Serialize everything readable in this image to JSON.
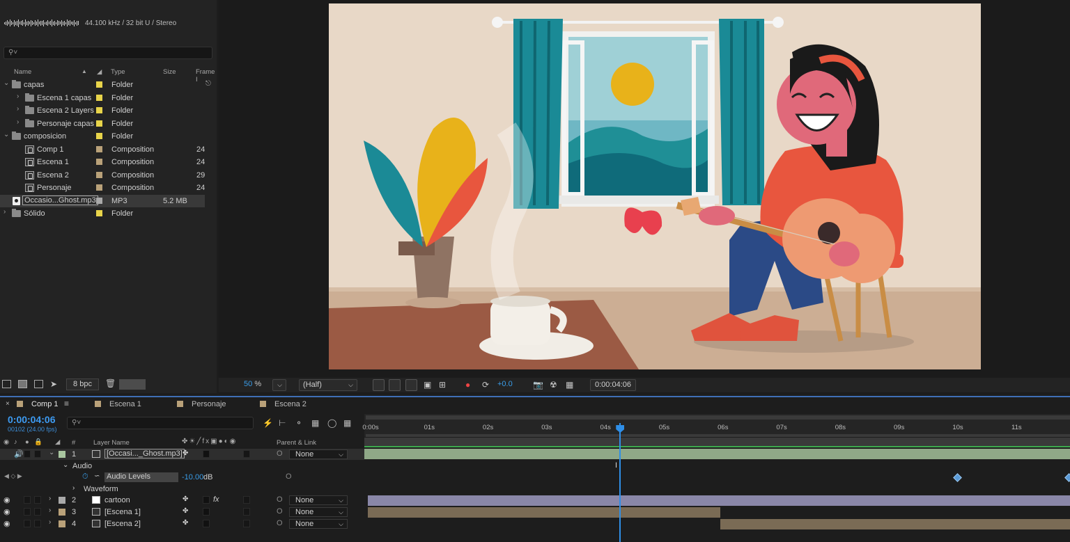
{
  "project": {
    "audio_info": "44.100 kHz / 32 bit U / Stereo",
    "columns": {
      "name": "Name",
      "type": "Type",
      "size": "Size",
      "frame": "Frame I"
    },
    "items": [
      {
        "name": "capas",
        "type": "Folder",
        "size": "",
        "frame": "",
        "label": "#e8d44a",
        "kind": "folder",
        "indent": 0,
        "open": true
      },
      {
        "name": "Escena 1 capas",
        "type": "Folder",
        "size": "",
        "frame": "",
        "label": "#e8d44a",
        "kind": "folder",
        "indent": 1,
        "open": false
      },
      {
        "name": "Escena 2 Layers",
        "type": "Folder",
        "size": "",
        "frame": "",
        "label": "#e8d44a",
        "kind": "folder",
        "indent": 1,
        "open": false
      },
      {
        "name": "Personaje capas",
        "type": "Folder",
        "size": "",
        "frame": "",
        "label": "#e8d44a",
        "kind": "folder",
        "indent": 1,
        "open": false
      },
      {
        "name": "composicion",
        "type": "Folder",
        "size": "",
        "frame": "",
        "label": "#e8d44a",
        "kind": "folder",
        "indent": 0,
        "open": true
      },
      {
        "name": "Comp 1",
        "type": "Composition",
        "size": "",
        "frame": "24",
        "label": "#b9a179",
        "kind": "comp",
        "indent": 1
      },
      {
        "name": "Escena 1",
        "type": "Composition",
        "size": "",
        "frame": "24",
        "label": "#b9a179",
        "kind": "comp",
        "indent": 1
      },
      {
        "name": "Escena 2",
        "type": "Composition",
        "size": "",
        "frame": "29",
        "label": "#b9a179",
        "kind": "comp",
        "indent": 1
      },
      {
        "name": "Personaje",
        "type": "Composition",
        "size": "",
        "frame": "24",
        "label": "#b9a179",
        "kind": "comp",
        "indent": 1
      },
      {
        "name": "Occasio...Ghost.mp3",
        "type": "MP3",
        "size": "5.2 MB",
        "frame": "",
        "label": "#a9a9a9",
        "kind": "audio",
        "indent": 0,
        "selected": true
      },
      {
        "name": "Sólido",
        "type": "Folder",
        "size": "",
        "frame": "",
        "label": "#e8d44a",
        "kind": "folder",
        "indent": 0,
        "open": false
      }
    ],
    "bpc": "8 bpc"
  },
  "viewer": {
    "zoom": "50",
    "zoom_unit": "%",
    "resolution": "(Half)",
    "exposure": "+0.0",
    "timecode": "0:00:04:06"
  },
  "timeline": {
    "tabs": [
      {
        "label": "Comp 1",
        "color": "#b9a179",
        "active": true
      },
      {
        "label": "Escena 1",
        "color": "#b9a179"
      },
      {
        "label": "Personaje",
        "color": "#b9a179"
      },
      {
        "label": "Escena 2",
        "color": "#b9a179"
      }
    ],
    "timecode": "0:00:04:06",
    "fps": "00102 (24.00 fps)",
    "header": {
      "num": "#",
      "layer_name": "Layer Name",
      "parent": "Parent & Link"
    },
    "ruler": [
      "0:00s",
      "01s",
      "02s",
      "03s",
      "04s",
      "05s",
      "06s",
      "07s",
      "08s",
      "09s",
      "10s",
      "11s"
    ],
    "current_time_seconds": 4.25,
    "layers": [
      {
        "num": "1",
        "name": "[Occasi..._Ghost.mp3]",
        "parent": "None",
        "label": "#a9c6a0",
        "kind": "audio"
      },
      {
        "num": "2",
        "name": "cartoon",
        "parent": "None",
        "label": "#a9a9a9",
        "kind": "solid",
        "fx": "fx"
      },
      {
        "num": "3",
        "name": "[Escena 1]",
        "parent": "None",
        "label": "#b9a179",
        "kind": "comp"
      },
      {
        "num": "4",
        "name": "[Escena 2]",
        "parent": "None",
        "label": "#b9a179",
        "kind": "comp"
      }
    ],
    "audio_group": "Audio",
    "audio_levels": {
      "label": "Audio Levels",
      "value": "-10.00",
      "unit": "dB"
    },
    "waveform": "Waveform",
    "keyframes_seconds": [
      10.0,
      12.0
    ]
  },
  "colors": {
    "accent": "#2f8fe8",
    "audio_bar": "#8fa887",
    "solid_bar": "#8a87a8",
    "comp_bar": "#7a6b55"
  }
}
